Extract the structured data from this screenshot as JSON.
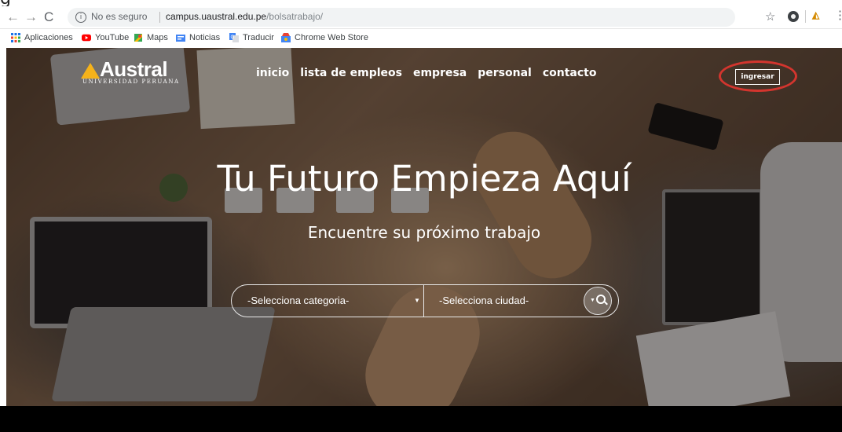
{
  "top_caption": "g",
  "browser": {
    "insecure_label": "No es seguro",
    "url_host": "campus.uaustral.edu.pe",
    "url_path": "/bolsatrabajo/"
  },
  "bookmarks": [
    {
      "label": "Aplicaciones",
      "icon": "apps-grid-icon",
      "color": "#1a73e8"
    },
    {
      "label": "YouTube",
      "icon": "youtube-icon",
      "color": "#ff0000"
    },
    {
      "label": "Maps",
      "icon": "maps-icon",
      "color": "#34a853"
    },
    {
      "label": "Noticias",
      "icon": "news-icon",
      "color": "#4285f4"
    },
    {
      "label": "Traducir",
      "icon": "translate-icon",
      "color": "#4285f4"
    },
    {
      "label": "Chrome Web Store",
      "icon": "webstore-icon",
      "color": "#ea4335"
    }
  ],
  "site": {
    "logo_name": "Austral",
    "logo_subtitle": "UNIVERSIDAD PERUANA",
    "logo_color": "#f5b21a",
    "nav": [
      "inicio",
      "lista de empleos",
      "empresa",
      "personal",
      "contacto"
    ],
    "login_label": "ingresar",
    "highlight_color": "#d3352e"
  },
  "hero": {
    "title": "Tu Futuro Empieza Aquí",
    "subtitle": "Encuentre su próximo trabajo"
  },
  "search": {
    "category_placeholder": "-Selecciona categoria-",
    "city_placeholder": "-Selecciona ciudad-"
  }
}
